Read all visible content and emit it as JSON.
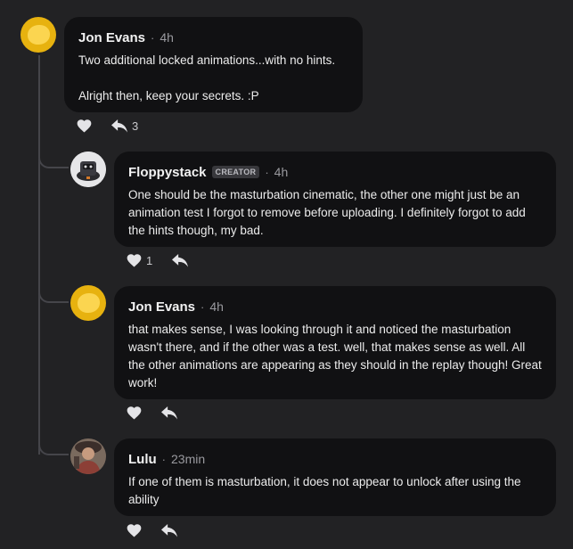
{
  "comments": [
    {
      "author": "Jon Evans",
      "time": "4h",
      "paragraphs": [
        "Two additional locked animations...with no hints.",
        "Alright then, keep your secrets. :P"
      ],
      "like_count": "",
      "reply_count": "3"
    },
    {
      "author": "Floppystack",
      "badge": "CREATOR",
      "time": "4h",
      "paragraphs": [
        "One should be the masturbation cinematic, the other one might just be an animation test I forgot to remove before uploading. I definitely forgot to add the hints though, my bad."
      ],
      "like_count": "1",
      "reply_count": ""
    },
    {
      "author": "Jon Evans",
      "time": "4h",
      "paragraphs": [
        "that makes sense, I was looking through it and noticed the masturbation wasn't there, and if the other was a test. well, that makes sense as well. All the other animations are appearing as they should in the replay though! Great work!"
      ],
      "like_count": "",
      "reply_count": ""
    },
    {
      "author": "Lulu",
      "time": "23min",
      "paragraphs": [
        "If one of them is masturbation, it does not appear to unlock after using the ability"
      ],
      "like_count": "",
      "reply_count": ""
    }
  ],
  "separator": "·",
  "icons": {
    "like": "heart-icon",
    "reply": "reply-arrow-icon"
  },
  "colors": {
    "background": "#222224",
    "bubble": "#111113",
    "avatar_yellow": "#e7b20f"
  }
}
